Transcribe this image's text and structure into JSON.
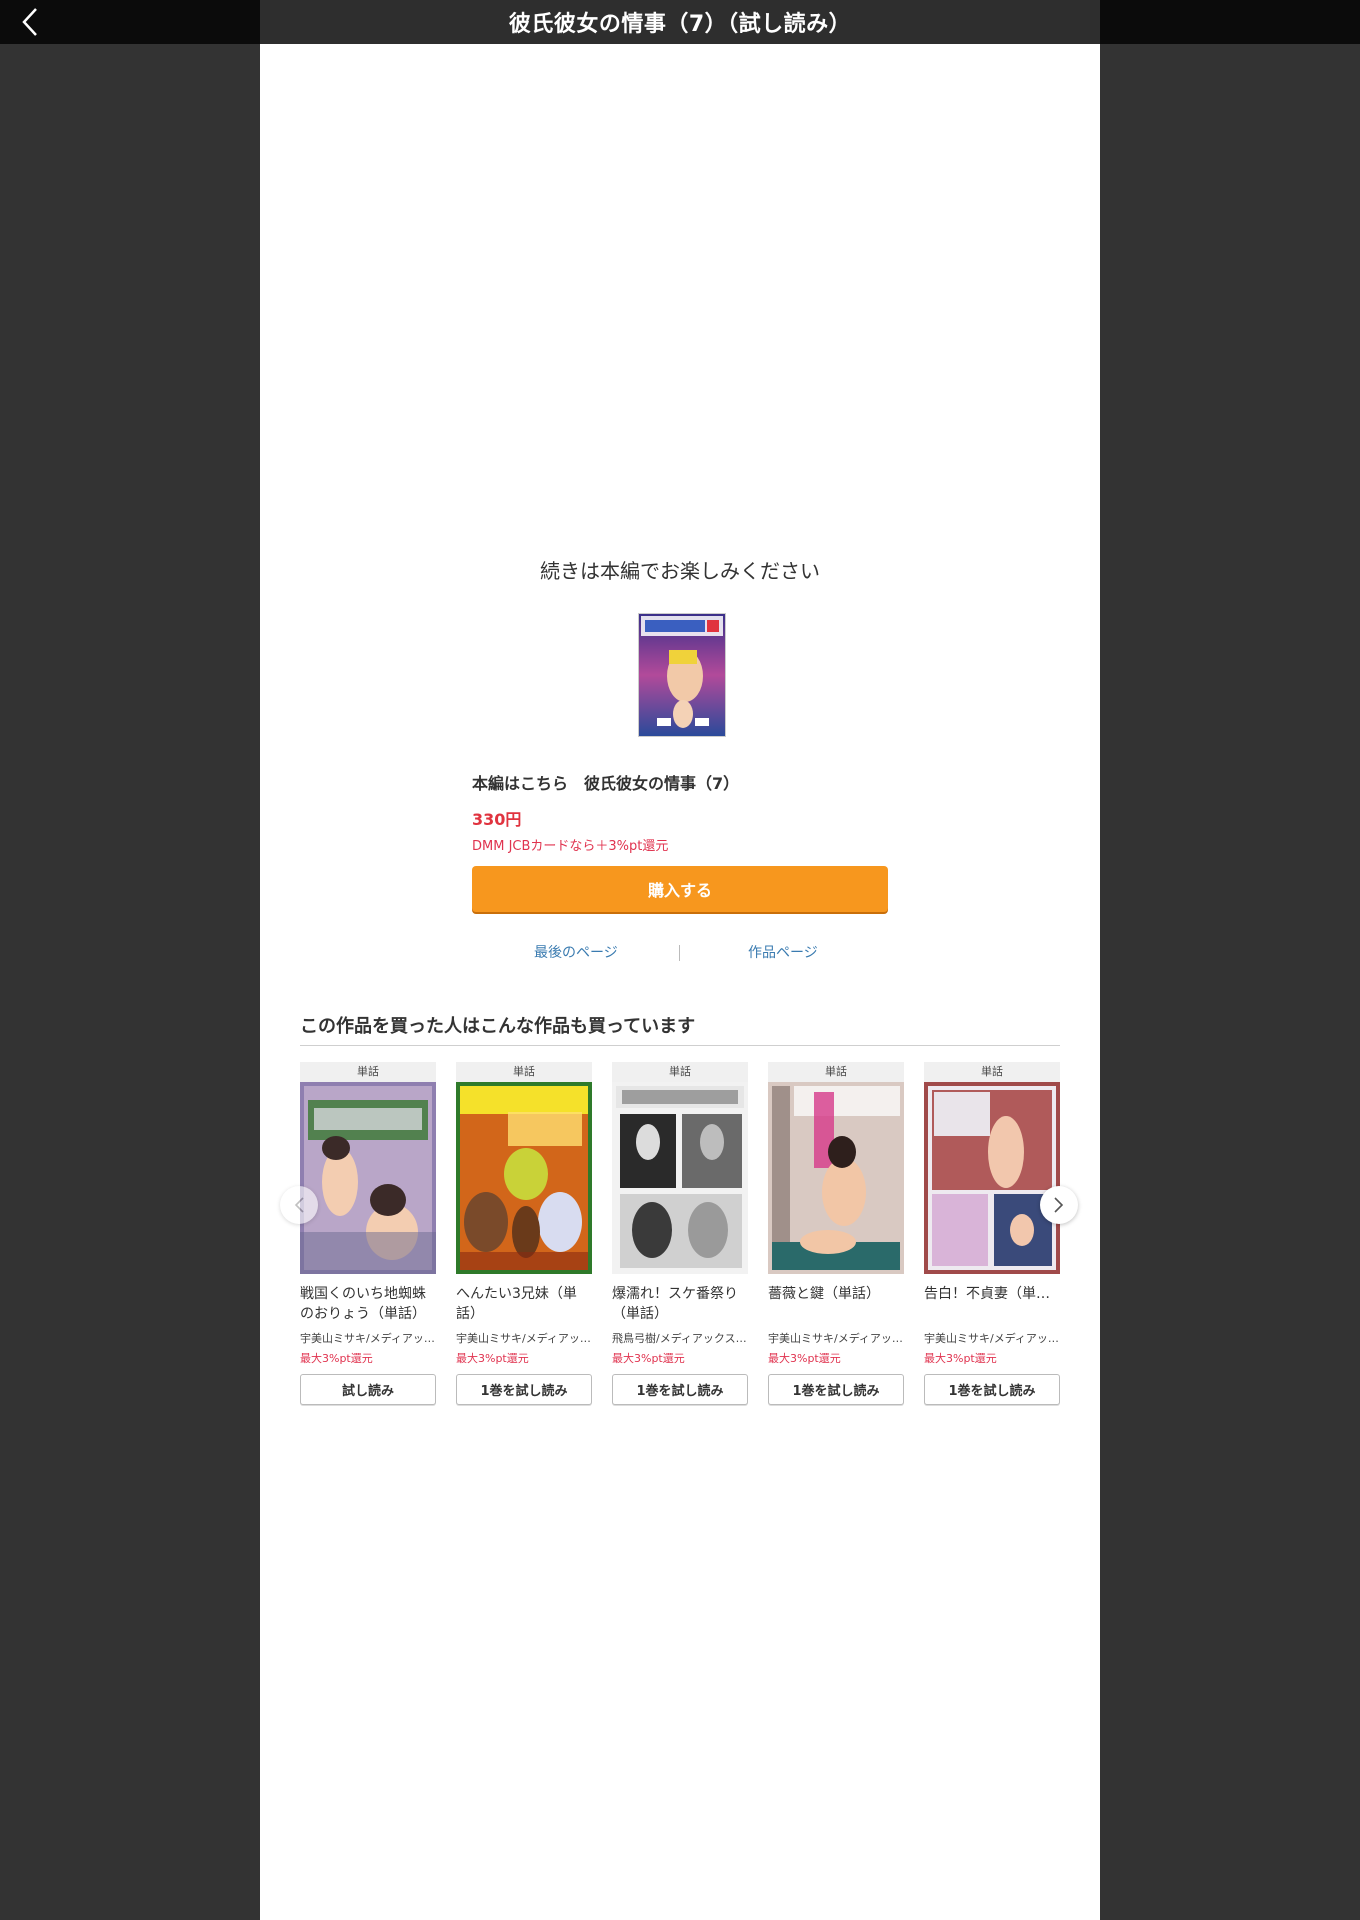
{
  "header": {
    "title": "彼氏彼女の情事（7）（試し読み）",
    "back_icon": "chevron-left-icon"
  },
  "end": {
    "message": "続きは本編でお楽しみください",
    "main_link": "本編はこちら　彼氏彼女の情事（7）",
    "price": "330円",
    "jcb": "DMM JCBカードなら＋3%pt還元",
    "buy_label": "購入する",
    "last_page_label": "最後のページ",
    "work_page_label": "作品ページ"
  },
  "recommend": {
    "title": "この作品を買った人はこんな作品も買っています",
    "items": [
      {
        "badge": "単話",
        "name": "戦国くのいち地蜘蛛のおりょう（単話）",
        "author": "宇美山ミサキ/メディアッ…",
        "pt": "最大3%pt還元",
        "button": "試し読み"
      },
      {
        "badge": "単話",
        "name": "へんたい3兄妹（単話）",
        "author": "宇美山ミサキ/メディアッ…",
        "pt": "最大3%pt還元",
        "button": "1巻を試し読み"
      },
      {
        "badge": "単話",
        "name": "爆濡れ！スケ番祭り（単話）",
        "author": "飛鳥弓樹/メディアックス…",
        "pt": "最大3%pt還元",
        "button": "1巻を試し読み"
      },
      {
        "badge": "単話",
        "name": "薔薇と鍵（単話）",
        "author": "宇美山ミサキ/メディアッ…",
        "pt": "最大3%pt還元",
        "button": "1巻を試し読み"
      },
      {
        "badge": "単話",
        "name": "告白！不貞妻（単…",
        "author": "宇美山ミサキ/メディアッ…",
        "pt": "最大3%pt還元",
        "button": "1巻を試し読み"
      }
    ]
  },
  "colors": {
    "accent": "#f7971e",
    "price": "#e0333f",
    "link": "#3a7bb0",
    "page_bg": "#333333"
  }
}
